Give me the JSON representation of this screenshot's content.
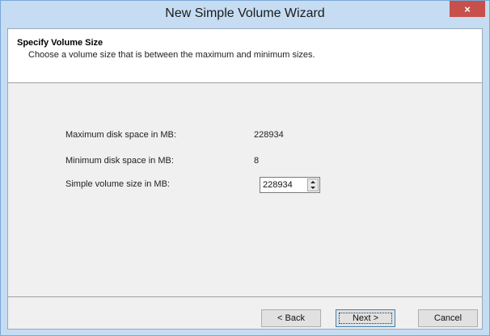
{
  "window": {
    "title": "New Simple Volume Wizard",
    "close_glyph": "×"
  },
  "header": {
    "title": "Specify Volume Size",
    "description": "Choose a volume size that is between the maximum and minimum sizes."
  },
  "fields": {
    "max_label": "Maximum disk space in MB:",
    "max_value": "228934",
    "min_label": "Minimum disk space in MB:",
    "min_value": "8",
    "size_label": "Simple volume size in MB:",
    "size_value": "228934"
  },
  "buttons": {
    "back": "< Back",
    "next": "Next >",
    "cancel": "Cancel"
  },
  "icons": {
    "close": "close-icon",
    "spin_up": "chevron-up-icon",
    "spin_down": "chevron-down-icon"
  },
  "colors": {
    "frame": "#c5dcf2",
    "close_button": "#c7504a",
    "default_button_border": "#3c7fb1"
  }
}
